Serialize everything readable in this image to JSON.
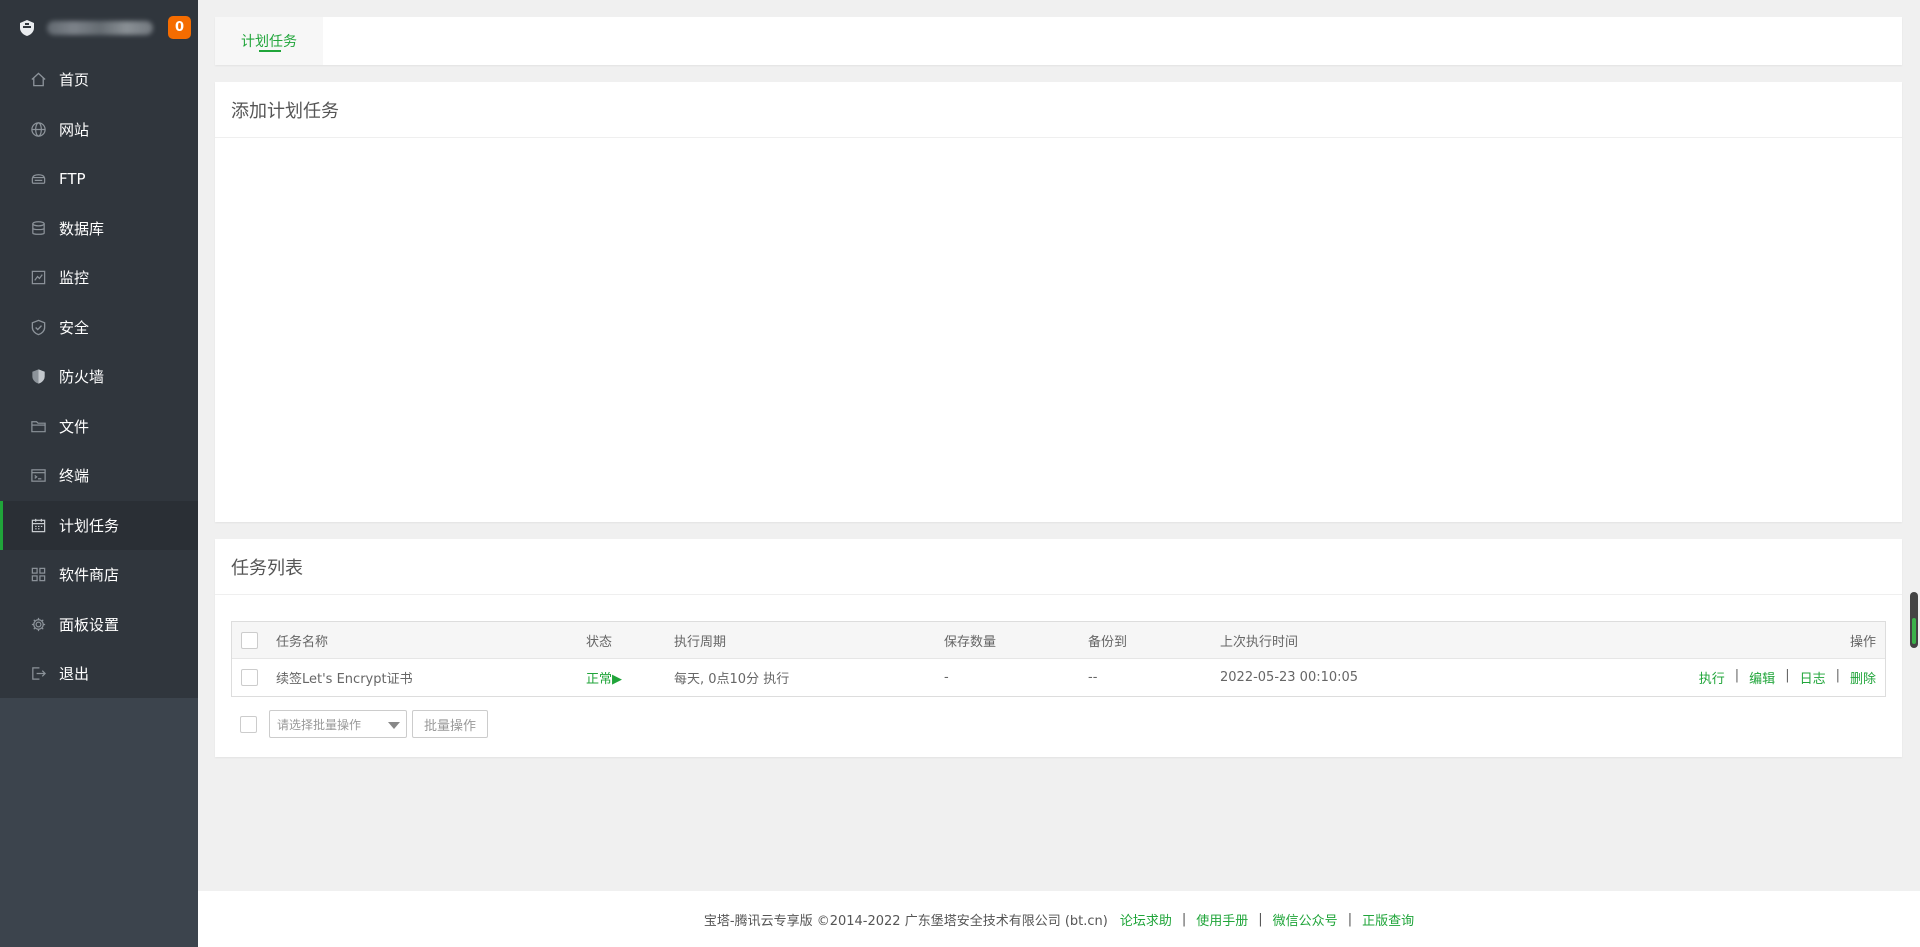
{
  "sidebar": {
    "badge": "0",
    "items": [
      {
        "label": "首页",
        "icon": "home-icon"
      },
      {
        "label": "网站",
        "icon": "globe-icon"
      },
      {
        "label": "FTP",
        "icon": "ftp-icon"
      },
      {
        "label": "数据库",
        "icon": "database-icon"
      },
      {
        "label": "监控",
        "icon": "monitor-icon"
      },
      {
        "label": "安全",
        "icon": "shield-check-icon"
      },
      {
        "label": "防火墙",
        "icon": "firewall-shield-icon"
      },
      {
        "label": "文件",
        "icon": "folder-icon"
      },
      {
        "label": "终端",
        "icon": "terminal-icon"
      },
      {
        "label": "计划任务",
        "icon": "calendar-icon",
        "active": true
      },
      {
        "label": "软件商店",
        "icon": "grid-apps-icon"
      },
      {
        "label": "面板设置",
        "icon": "gear-icon"
      },
      {
        "label": "退出",
        "icon": "logout-icon"
      }
    ]
  },
  "tabs": [
    {
      "label": "计划任务"
    }
  ],
  "add_section": {
    "title": "添加计划任务"
  },
  "list_section": {
    "title": "任务列表",
    "columns": [
      "任务名称",
      "状态",
      "执行周期",
      "保存数量",
      "备份到",
      "上次执行时间",
      "操作"
    ],
    "rows": [
      {
        "name": "续签Let's Encrypt证书",
        "status": "正常▶",
        "cycle": "每天, 0点10分 执行",
        "keep": "-",
        "backup_to": "--",
        "last_run": "2022-05-23 00:10:05",
        "actions": [
          "执行",
          "编辑",
          "日志",
          "删除"
        ]
      }
    ],
    "batch_placeholder": "请选择批量操作",
    "batch_button": "批量操作"
  },
  "footer": {
    "copyright": "宝塔-腾讯云专享版 ©2014-2022 广东堡塔安全技术有限公司 (bt.cn)",
    "links": [
      "论坛求助",
      "使用手册",
      "微信公众号",
      "正版查询"
    ]
  },
  "colors": {
    "accent": "#20a53a",
    "sidebar_bg": "#30363d",
    "badge": "#f56c00"
  }
}
